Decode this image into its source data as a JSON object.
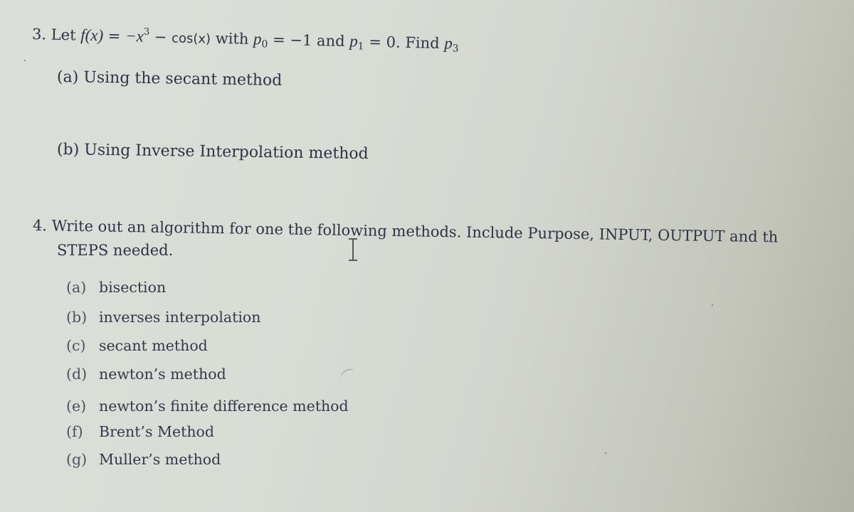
{
  "question3": {
    "number": "3.",
    "lead": "Let",
    "function_lhs": "f(x)",
    "equals": "=",
    "neg_x": "−x",
    "exponent": "3",
    "minus": "−",
    "cos_term": "cos(x)",
    "with_text": "with",
    "p0_symbol": "p",
    "p0_sub": "0",
    "p0_value": "= −1",
    "and_text": "and",
    "p1_symbol": "p",
    "p1_sub": "1",
    "p1_value": "= 0.",
    "find_text": "Find",
    "p3_symbol": "p",
    "p3_sub": "3",
    "parts": [
      {
        "label": "(a)",
        "text": "Using the secant method"
      },
      {
        "label": "(b)",
        "text": "Using Inverse Interpolation method"
      }
    ]
  },
  "question4": {
    "number": "4.",
    "line1": "Write out an algorithm for one the following methods.  Include Purpose, INPUT, OUTPUT and th",
    "line2": "STEPS needed.",
    "options": [
      {
        "label": "(a)",
        "text": "bisection"
      },
      {
        "label": "(b)",
        "text": "inverses interpolation"
      },
      {
        "label": "(c)",
        "text": "secant method"
      },
      {
        "label": "(d)",
        "text": "newton’s method"
      },
      {
        "label": "(e)",
        "text": "newton’s finite difference method"
      },
      {
        "label": "(f)",
        "text": "Brent’s Method"
      },
      {
        "label": "(g)",
        "text": "Muller’s method"
      }
    ]
  },
  "cursor": {
    "type": "text-ibeam-cursor"
  }
}
